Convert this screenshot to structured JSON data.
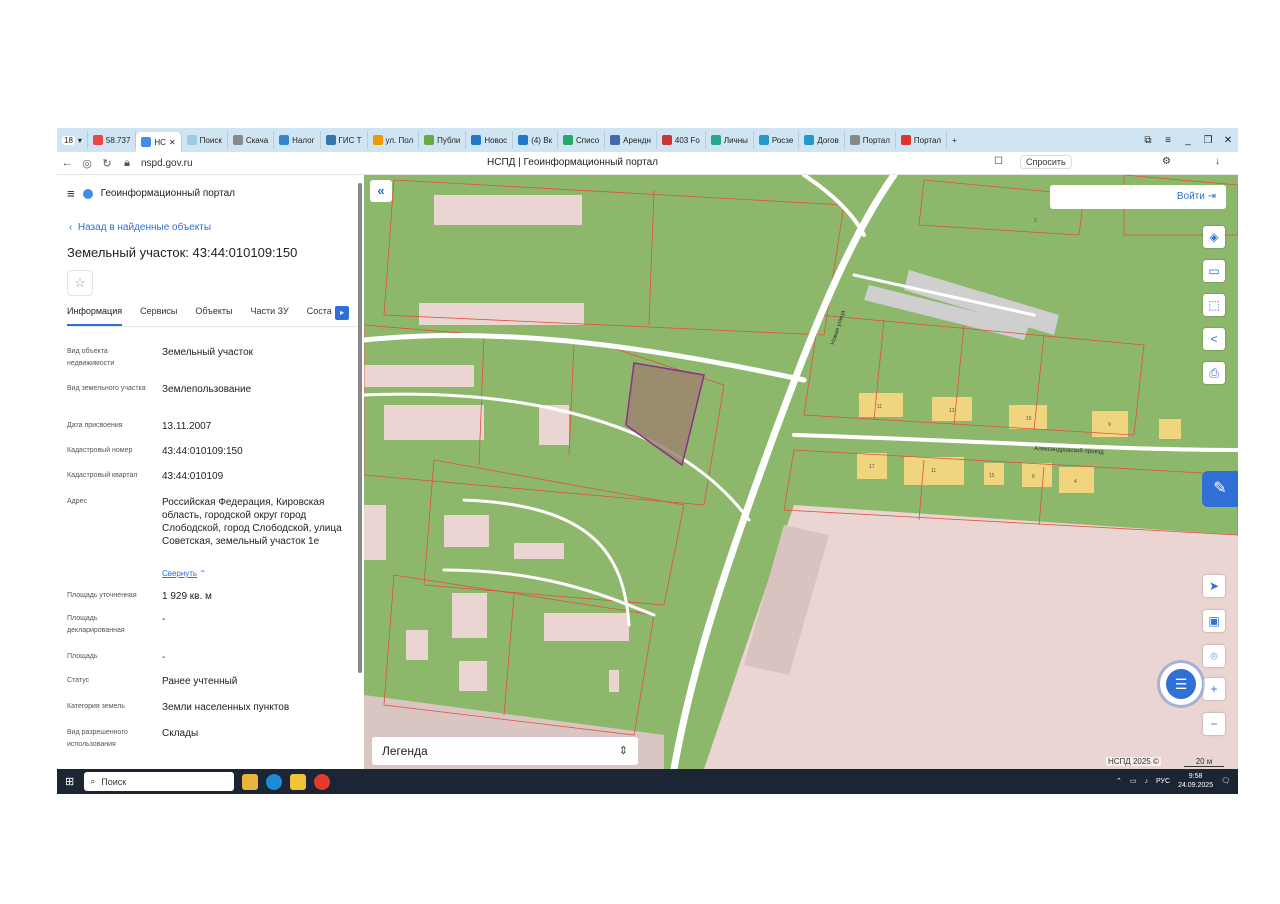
{
  "browser": {
    "tab_count": "18",
    "tabs": [
      {
        "label": "58.737",
        "color": "#e44"
      },
      {
        "label": "НС",
        "color": "#3d8ee6",
        "active": true
      },
      {
        "label": "Поиск",
        "color": "#9cd"
      },
      {
        "label": "Скача",
        "color": "#888"
      },
      {
        "label": "Налог",
        "color": "#38c"
      },
      {
        "label": "ГИС Т",
        "color": "#37a"
      },
      {
        "label": "ул. Пол",
        "color": "#e90"
      },
      {
        "label": "Публи",
        "color": "#6a4"
      },
      {
        "label": "Новос",
        "color": "#27c"
      },
      {
        "label": "(4) Вк",
        "color": "#27c"
      },
      {
        "label": "Списо",
        "color": "#2a6"
      },
      {
        "label": "Арендн",
        "color": "#46a"
      },
      {
        "label": "403 Fo",
        "color": "#c33"
      },
      {
        "label": "Личны",
        "color": "#2a8"
      },
      {
        "label": "Росзе",
        "color": "#29c"
      },
      {
        "label": "Догов",
        "color": "#29c"
      },
      {
        "label": "Портал",
        "color": "#888"
      },
      {
        "label": "Портал",
        "color": "#d33"
      }
    ],
    "url": "nspd.gov.ru",
    "page_title": "НСПД | Геоинформационный портал",
    "ask_label": "Спросить"
  },
  "panel": {
    "portal_name": "Геоинформационный портал",
    "back_link": "Назад в найденные объекты",
    "title": "Земельный участок: 43:44:010109:150",
    "tabs": [
      "Информация",
      "Сервисы",
      "Объекты",
      "Части ЗУ",
      "Соста"
    ],
    "fields": [
      {
        "label": "Вид объекта недвижимости",
        "value": "Земельный участок"
      },
      {
        "label": "Вид земельного участка",
        "value": "Землепользование"
      },
      {
        "label": "Дата присвоения",
        "value": "13.11.2007"
      },
      {
        "label": "Кадастровый номер",
        "value": "43:44:010109:150"
      },
      {
        "label": "Кадастровый квартал",
        "value": "43:44:010109"
      },
      {
        "label": "Адрес",
        "value": "Российская Федерация, Кировская область, городской округ город Слободской, город Слободской, улица Советская, земельный участок 1е"
      },
      {
        "label": "Площадь уточненная",
        "value": "1 929 кв. м"
      },
      {
        "label": "Площадь декларированная",
        "value": "-"
      },
      {
        "label": "Площадь",
        "value": "-"
      },
      {
        "label": "Статус",
        "value": "Ранее учтенный"
      },
      {
        "label": "Категория земель",
        "value": "Земли населенных пунктов"
      },
      {
        "label": "Вид разрешенного использования",
        "value": "Склады"
      }
    ],
    "collapse_label": "Свернуть"
  },
  "map": {
    "login_label": "Войти",
    "legend_label": "Легенда",
    "attribution": "НСПД 2025 ©",
    "scale": "20 м",
    "streets": {
      "vertical": "Новая улица",
      "horizontal": "Александровский проезд"
    },
    "house_numbers": [
      "11",
      "13",
      "15",
      "9",
      "17",
      "11",
      "15",
      "6",
      "4",
      "2"
    ],
    "colors": {
      "green": "#8db86b",
      "pink": "#ead5d2",
      "parcel_line": "#e05040",
      "selected": "#8b2f8b",
      "accent": "#2f6fd6"
    }
  },
  "taskbar": {
    "search_label": "Поиск",
    "lang": "РУС",
    "time": "9:58",
    "date": "24.09.2025"
  }
}
